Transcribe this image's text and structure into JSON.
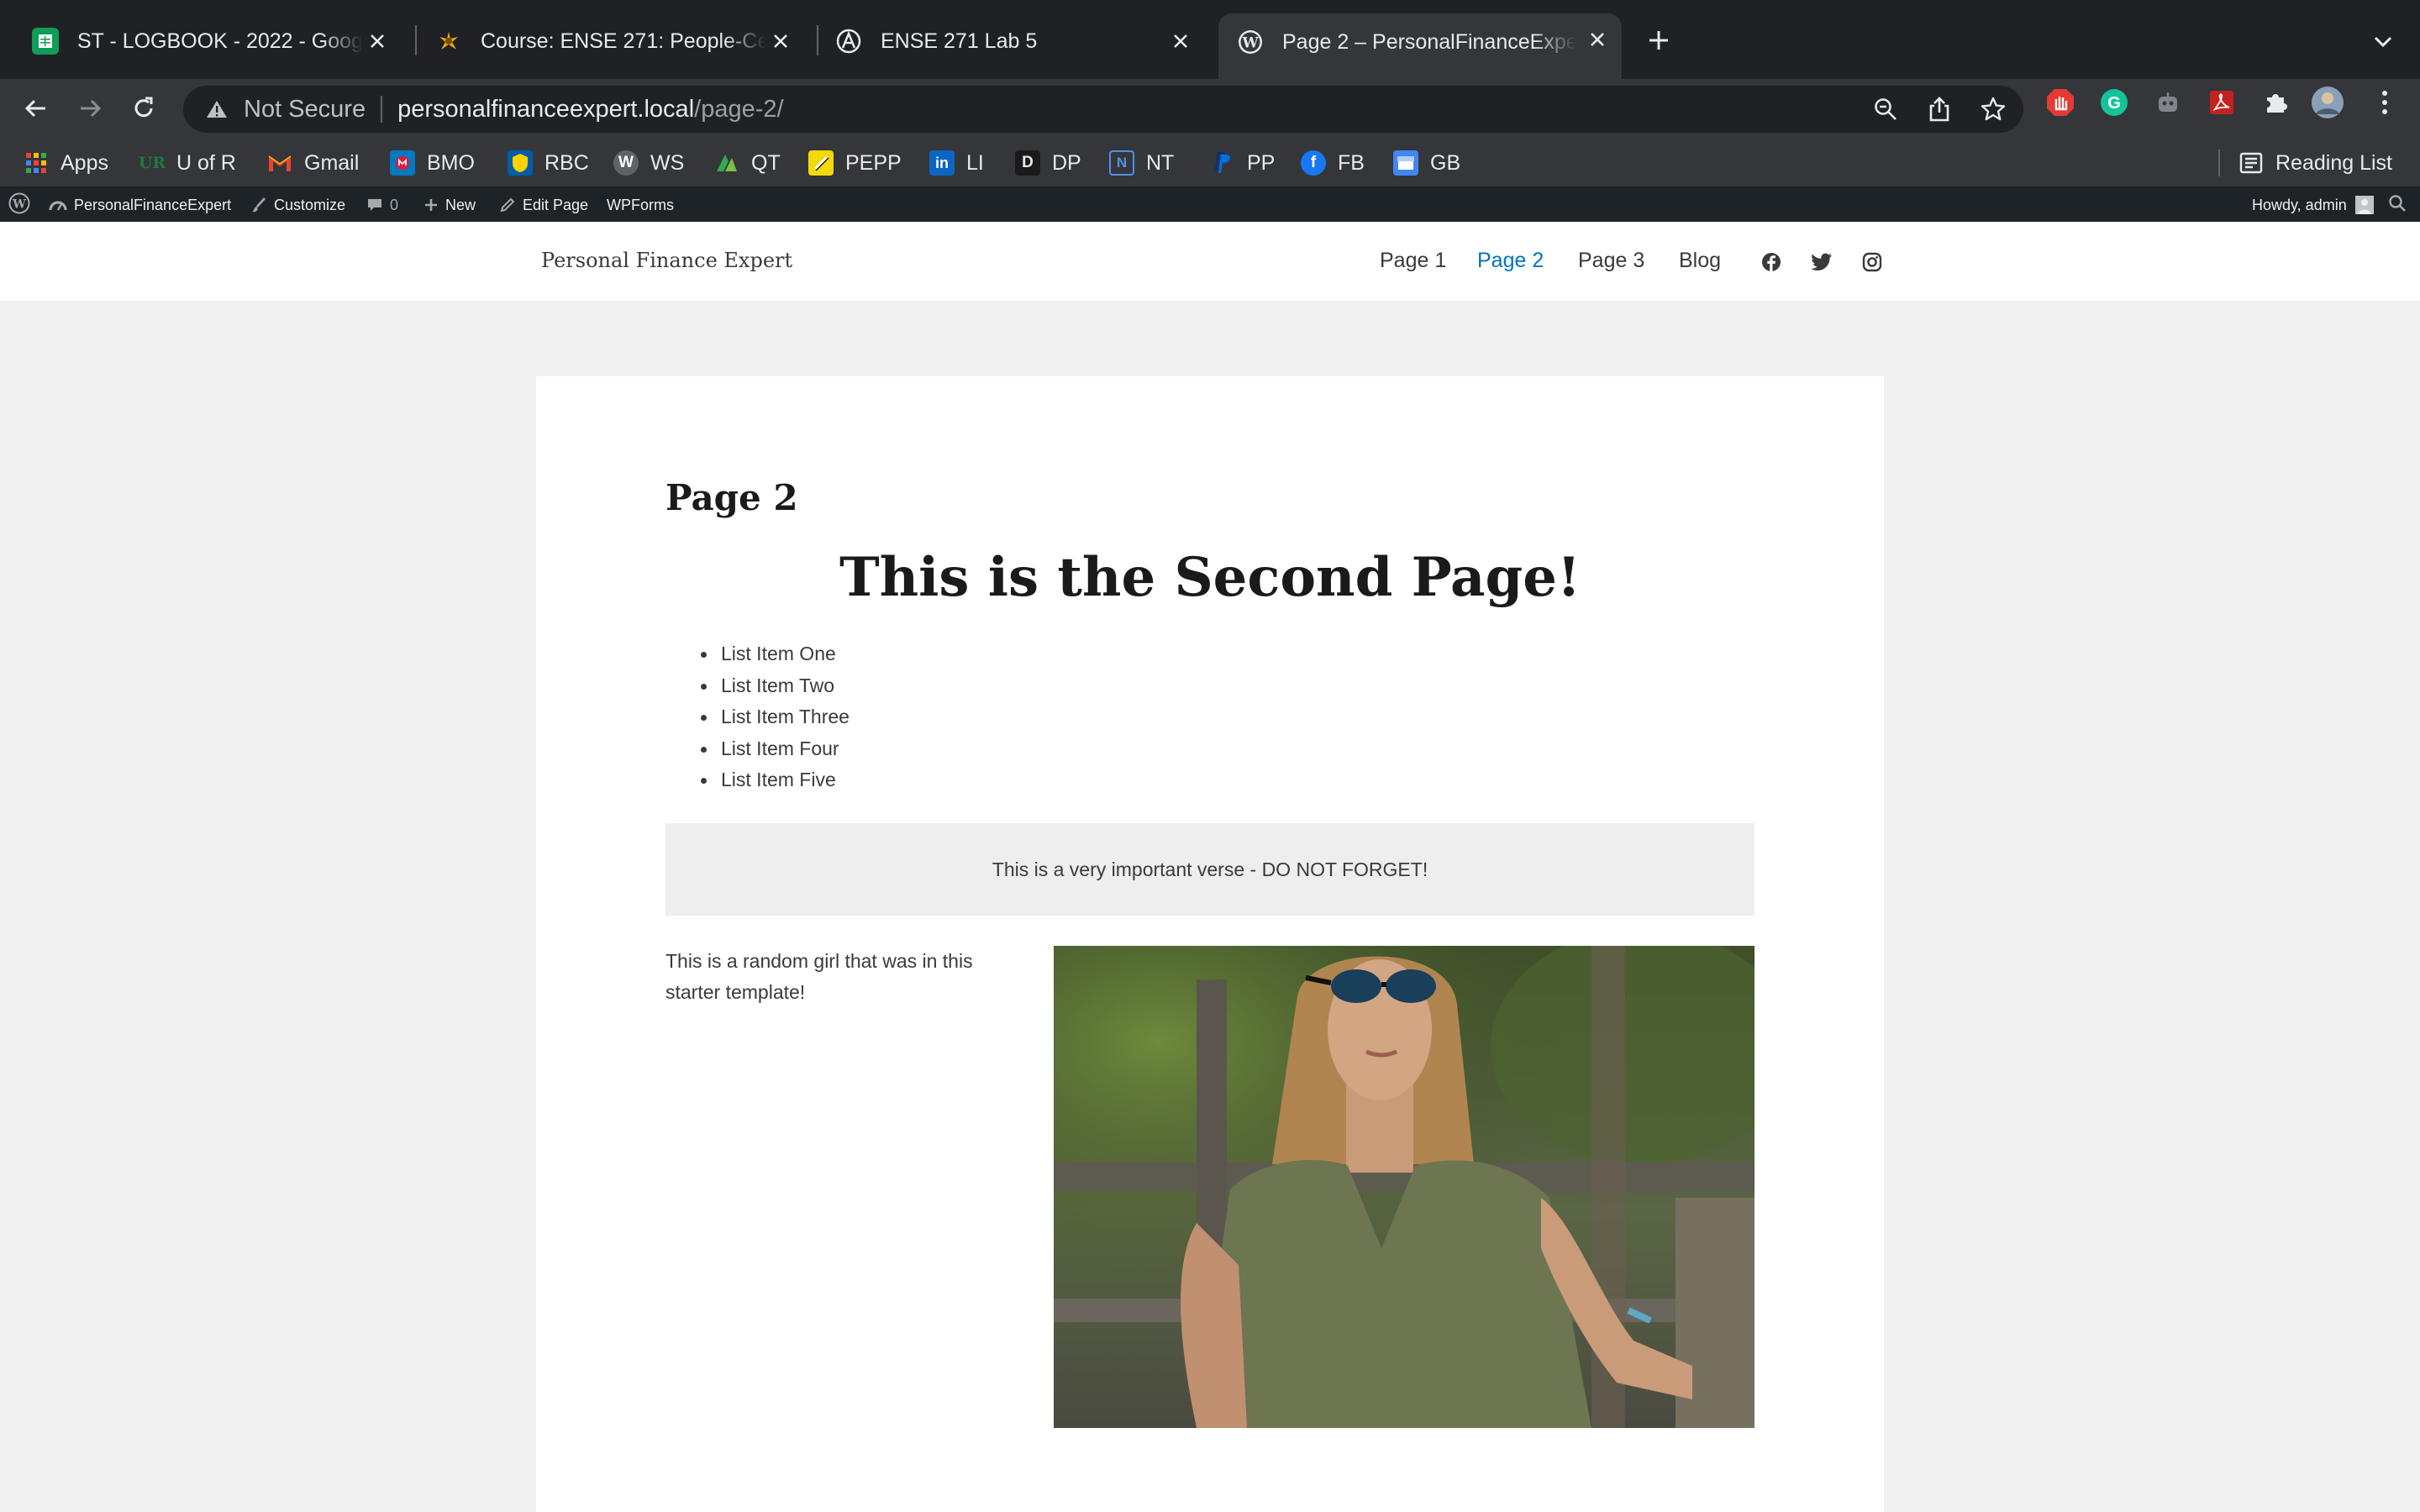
{
  "browser": {
    "tabs": [
      {
        "title": "ST - LOGBOOK - 2022 - Google Sheets",
        "favicon": "sheets-icon"
      },
      {
        "title": "Course: ENSE 271: People-Centred Design",
        "favicon": "moodle-icon"
      },
      {
        "title": "ENSE 271 Lab 5",
        "favicon": "site-icon"
      },
      {
        "title": "Page 2 – PersonalFinanceExpert",
        "favicon": "wordpress-icon",
        "active": true
      }
    ],
    "omnibox": {
      "security_label": "Not Secure",
      "url_host": "personalfinanceexpert.local",
      "url_path": "/page-2/"
    },
    "bookmarks": [
      {
        "label": "Apps",
        "color": "#ea4335"
      },
      {
        "label": "U of R",
        "color": "#0f5132"
      },
      {
        "label": "Gmail",
        "color": "#ea4335"
      },
      {
        "label": "BMO",
        "color": "#0079c1"
      },
      {
        "label": "RBC",
        "color": "#005daa"
      },
      {
        "label": "WS",
        "color": "#4a4a4a"
      },
      {
        "label": "QT",
        "color": "#34a853"
      },
      {
        "label": "PEPP",
        "color": "#f5d90a"
      },
      {
        "label": "LI",
        "color": "#0a66c2"
      },
      {
        "label": "DP",
        "color": "#1a1a1a"
      },
      {
        "label": "NT",
        "color": "#1a73e8"
      },
      {
        "label": "PP",
        "color": "#003087"
      },
      {
        "label": "FB",
        "color": "#1877f2"
      },
      {
        "label": "GB",
        "color": "#4285f4"
      }
    ],
    "reading_list_label": "Reading List"
  },
  "adminbar": {
    "site_name": "PersonalFinanceExpert",
    "customize": "Customize",
    "comments_count": "0",
    "new_label": "New",
    "edit_page": "Edit Page",
    "wpforms": "WPForms",
    "howdy": "Howdy, admin"
  },
  "site": {
    "title": "Personal Finance Expert",
    "nav": [
      "Page 1",
      "Page 2",
      "Page 3",
      "Blog"
    ],
    "current_nav": "Page 2",
    "accent_color": "#0274be",
    "social_icons": [
      "facebook-icon",
      "twitter-icon",
      "instagram-icon"
    ]
  },
  "page": {
    "heading": "Page 2",
    "big_heading": "This is the Second Page!",
    "list_items": [
      "List Item One",
      "List Item Two",
      "List Item Three",
      "List Item Four",
      "List Item Five"
    ],
    "verse": "This is a very important verse - DO NOT FORGET!",
    "caption": "This is a random girl that was in this starter template!"
  }
}
